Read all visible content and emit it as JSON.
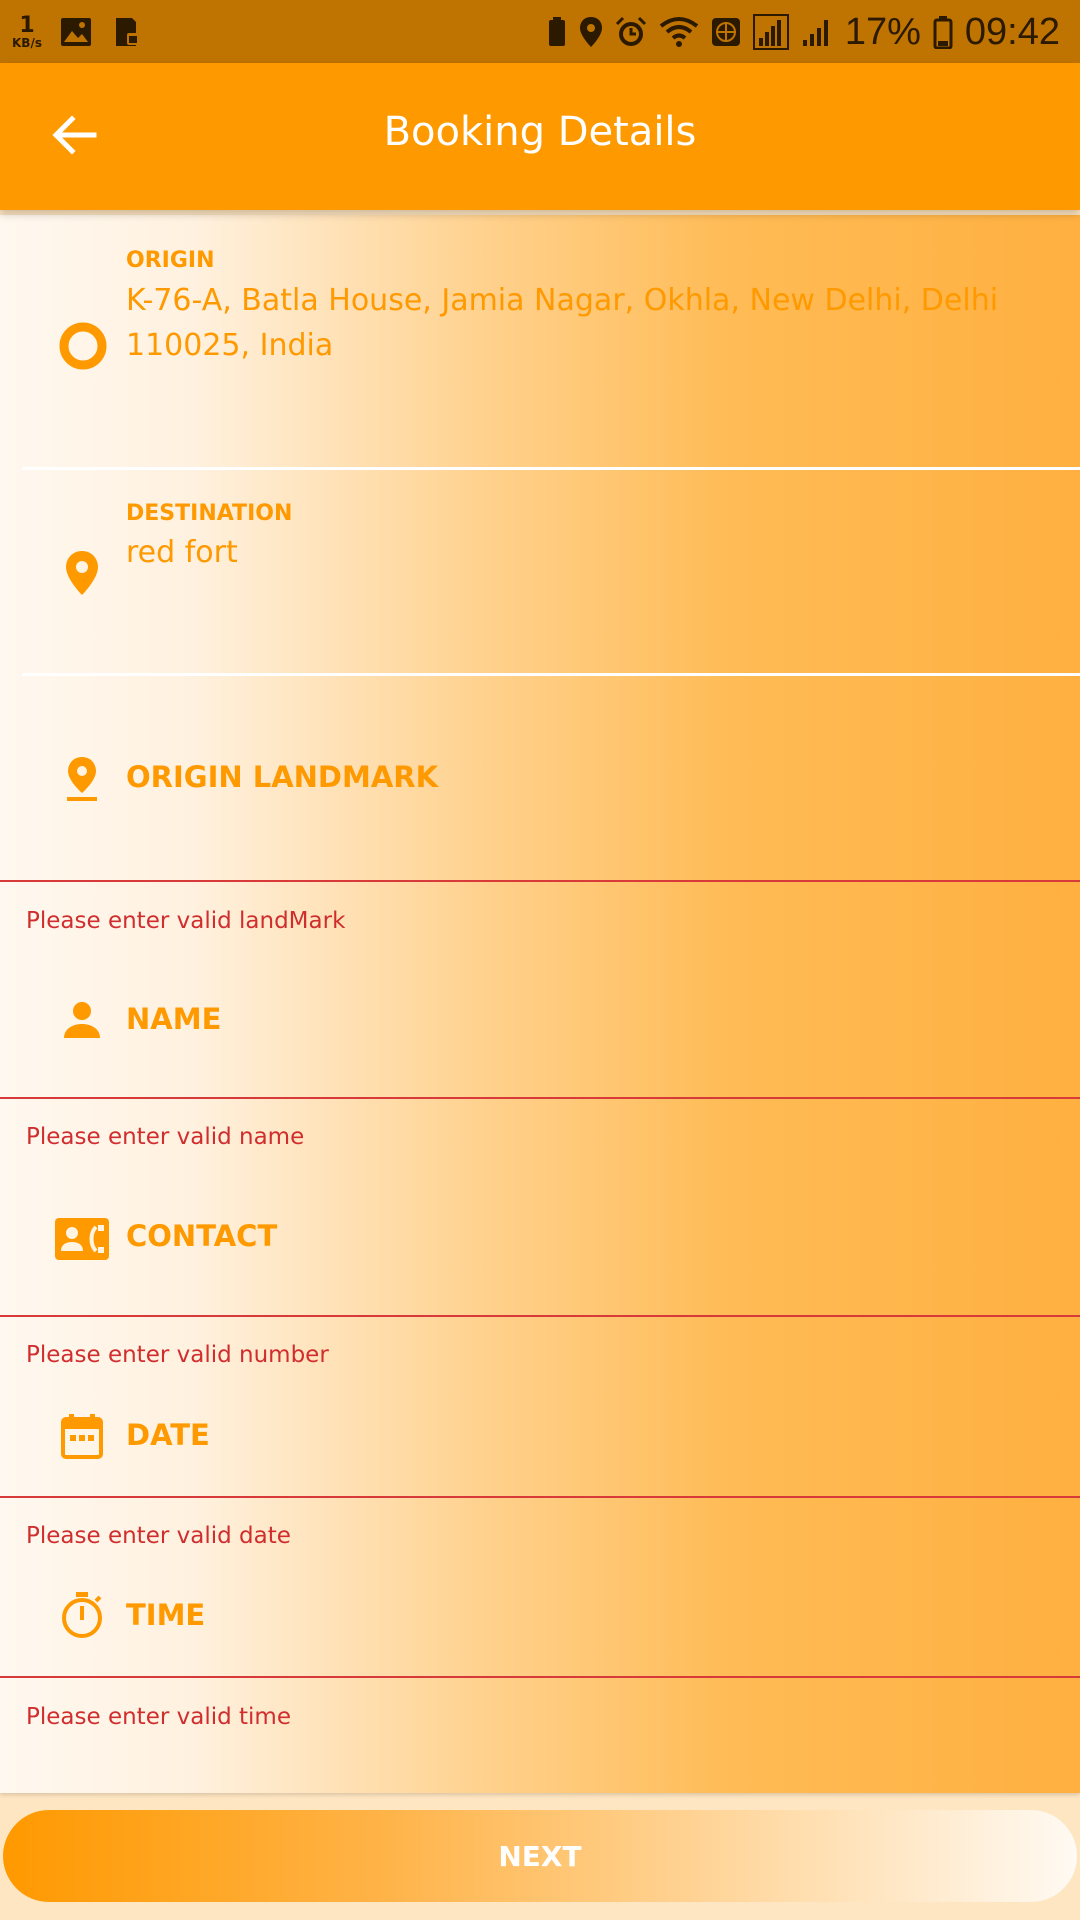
{
  "status_bar": {
    "net_speed_value": "1",
    "net_speed_unit": "KB/s",
    "battery_percent": "17%",
    "time": "09:42"
  },
  "app_bar": {
    "title": "Booking Details"
  },
  "origin": {
    "label": "ORIGIN",
    "value": "K-76-A, Batla House, Jamia Nagar, Okhla, New Delhi, Delhi 110025, India"
  },
  "destination": {
    "label": "DESTINATION",
    "value": "red fort"
  },
  "fields": {
    "origin_landmark": {
      "placeholder": "ORIGIN LANDMARK",
      "error": "Please enter valid landMark"
    },
    "name": {
      "placeholder": "NAME",
      "error": "Please enter valid name"
    },
    "contact": {
      "placeholder": "CONTACT",
      "error": "Please enter valid number"
    },
    "date": {
      "placeholder": "DATE",
      "error": "Please enter valid date"
    },
    "time": {
      "placeholder": "TIME",
      "error": "Please enter valid time"
    }
  },
  "next_button": {
    "label": "NEXT"
  },
  "colors": {
    "accent": "#ff9900",
    "status_bar": "#bf7300",
    "error": "#d02e2e"
  }
}
